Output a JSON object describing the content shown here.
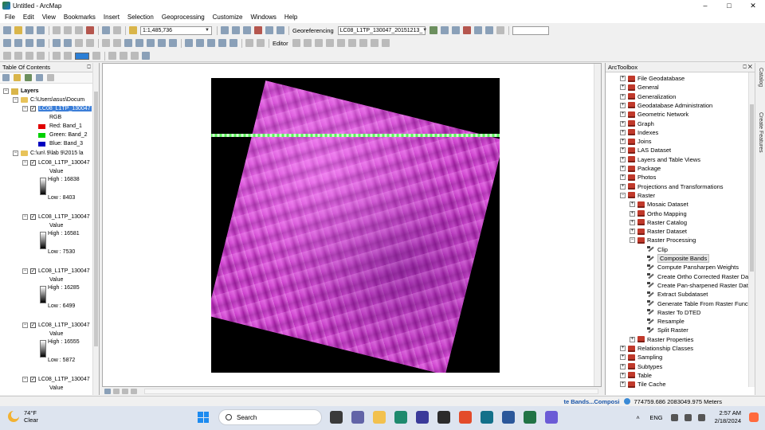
{
  "window": {
    "title": "Untitled - ArcMap",
    "controls": [
      "–",
      "□",
      "✕"
    ]
  },
  "menu": [
    "File",
    "Edit",
    "View",
    "Bookmarks",
    "Insert",
    "Selection",
    "Geoprocessing",
    "Customize",
    "Windows",
    "Help"
  ],
  "toolbar": {
    "scale": "1:1,485,736",
    "georeferencing_label": "Georeferencing",
    "georef_layer": "LC08_L1TP_130047_20151213_",
    "editor_label": "Editor"
  },
  "toc": {
    "title": "Table Of Contents",
    "header_buttons": "⎕ ✕",
    "root": "Layers",
    "group1_path": "C:\\Users\\asus\\Docum",
    "selected_layer": "LC08_L1TP_130047",
    "rgb_label": "RGB",
    "red": "Red:    Band_1",
    "green": "Green: Band_2",
    "blue": "Blue:   Band_3",
    "group2_path": "C:\\un\\ 9\\lab 9\\2015 la",
    "bands": [
      {
        "name": "LC08_L1TP_130047",
        "value_label": "Value",
        "high": "High : 16838",
        "low": "Low : 8403"
      },
      {
        "name": "LC08_L1TP_130047",
        "value_label": "Value",
        "high": "High : 16581",
        "low": "Low : 7530"
      },
      {
        "name": "LC08_L1TP_130047",
        "value_label": "Value",
        "high": "High : 16285",
        "low": "Low : 6499"
      },
      {
        "name": "LC08_L1TP_130047",
        "value_label": "Value",
        "high": "High : 16555",
        "low": "Low : 5872"
      },
      {
        "name": "LC08_L1TP_130047",
        "value_label": "Value"
      }
    ],
    "colors": {
      "red": "#e00000",
      "green": "#00d000",
      "blue": "#0000c0"
    }
  },
  "arctoolbox": {
    "title": "ArcToolbox",
    "header_buttons": "⎕ ✕",
    "items": [
      {
        "label": "File Geodatabase",
        "level": 0,
        "kind": "toolbox",
        "exp": "+"
      },
      {
        "label": "General",
        "level": 0,
        "kind": "toolbox",
        "exp": "+"
      },
      {
        "label": "Generalization",
        "level": 0,
        "kind": "toolbox",
        "exp": "+"
      },
      {
        "label": "Geodatabase Administration",
        "level": 0,
        "kind": "toolbox",
        "exp": "+"
      },
      {
        "label": "Geometric Network",
        "level": 0,
        "kind": "toolbox",
        "exp": "+"
      },
      {
        "label": "Graph",
        "level": 0,
        "kind": "toolbox",
        "exp": "+"
      },
      {
        "label": "Indexes",
        "level": 0,
        "kind": "toolbox",
        "exp": "+"
      },
      {
        "label": "Joins",
        "level": 0,
        "kind": "toolbox",
        "exp": "+"
      },
      {
        "label": "LAS Dataset",
        "level": 0,
        "kind": "toolbox",
        "exp": "+"
      },
      {
        "label": "Layers and Table Views",
        "level": 0,
        "kind": "toolbox",
        "exp": "+"
      },
      {
        "label": "Package",
        "level": 0,
        "kind": "toolbox",
        "exp": "+"
      },
      {
        "label": "Photos",
        "level": 0,
        "kind": "toolbox",
        "exp": "+"
      },
      {
        "label": "Projections and Transformations",
        "level": 0,
        "kind": "toolbox",
        "exp": "+"
      },
      {
        "label": "Raster",
        "level": 0,
        "kind": "toolbox",
        "exp": "−"
      },
      {
        "label": "Mosaic Dataset",
        "level": 1,
        "kind": "toolbox",
        "exp": "+"
      },
      {
        "label": "Ortho Mapping",
        "level": 1,
        "kind": "toolbox",
        "exp": "+"
      },
      {
        "label": "Raster Catalog",
        "level": 1,
        "kind": "toolbox",
        "exp": "+"
      },
      {
        "label": "Raster Dataset",
        "level": 1,
        "kind": "toolbox",
        "exp": "+"
      },
      {
        "label": "Raster Processing",
        "level": 1,
        "kind": "toolbox",
        "exp": "−"
      },
      {
        "label": "Clip",
        "level": 2,
        "kind": "tool"
      },
      {
        "label": "Composite Bands",
        "level": 2,
        "kind": "tool",
        "highlight": true
      },
      {
        "label": "Compute Pansharpen Weights",
        "level": 2,
        "kind": "tool"
      },
      {
        "label": "Create Ortho Corrected Raster Dat",
        "level": 2,
        "kind": "tool"
      },
      {
        "label": "Create Pan-sharpened Raster Data",
        "level": 2,
        "kind": "tool"
      },
      {
        "label": "Extract Subdataset",
        "level": 2,
        "kind": "tool"
      },
      {
        "label": "Generate Table From Raster Functi",
        "level": 2,
        "kind": "tool"
      },
      {
        "label": "Raster To DTED",
        "level": 2,
        "kind": "tool"
      },
      {
        "label": "Resample",
        "level": 2,
        "kind": "tool"
      },
      {
        "label": "Split Raster",
        "level": 2,
        "kind": "tool"
      },
      {
        "label": "Raster Properties",
        "level": 1,
        "kind": "toolbox",
        "exp": "+"
      },
      {
        "label": "Relationship Classes",
        "level": 0,
        "kind": "toolbox",
        "exp": "+"
      },
      {
        "label": "Sampling",
        "level": 0,
        "kind": "toolbox",
        "exp": "+"
      },
      {
        "label": "Subtypes",
        "level": 0,
        "kind": "toolbox",
        "exp": "+"
      },
      {
        "label": "Table",
        "level": 0,
        "kind": "toolbox",
        "exp": "+"
      },
      {
        "label": "Tile Cache",
        "level": 0,
        "kind": "toolbox",
        "exp": "+"
      }
    ]
  },
  "side_tabs": [
    "Catalog",
    "Create Features"
  ],
  "status": {
    "running_tool": "te Bands...Composi",
    "coords": "774759.686  2083049.975 Meters"
  },
  "taskbar": {
    "temperature": "74°F",
    "condition": "Clear",
    "search_label": "Search",
    "language": "ENG",
    "time": "2:57 AM",
    "date": "2/18/2024"
  }
}
